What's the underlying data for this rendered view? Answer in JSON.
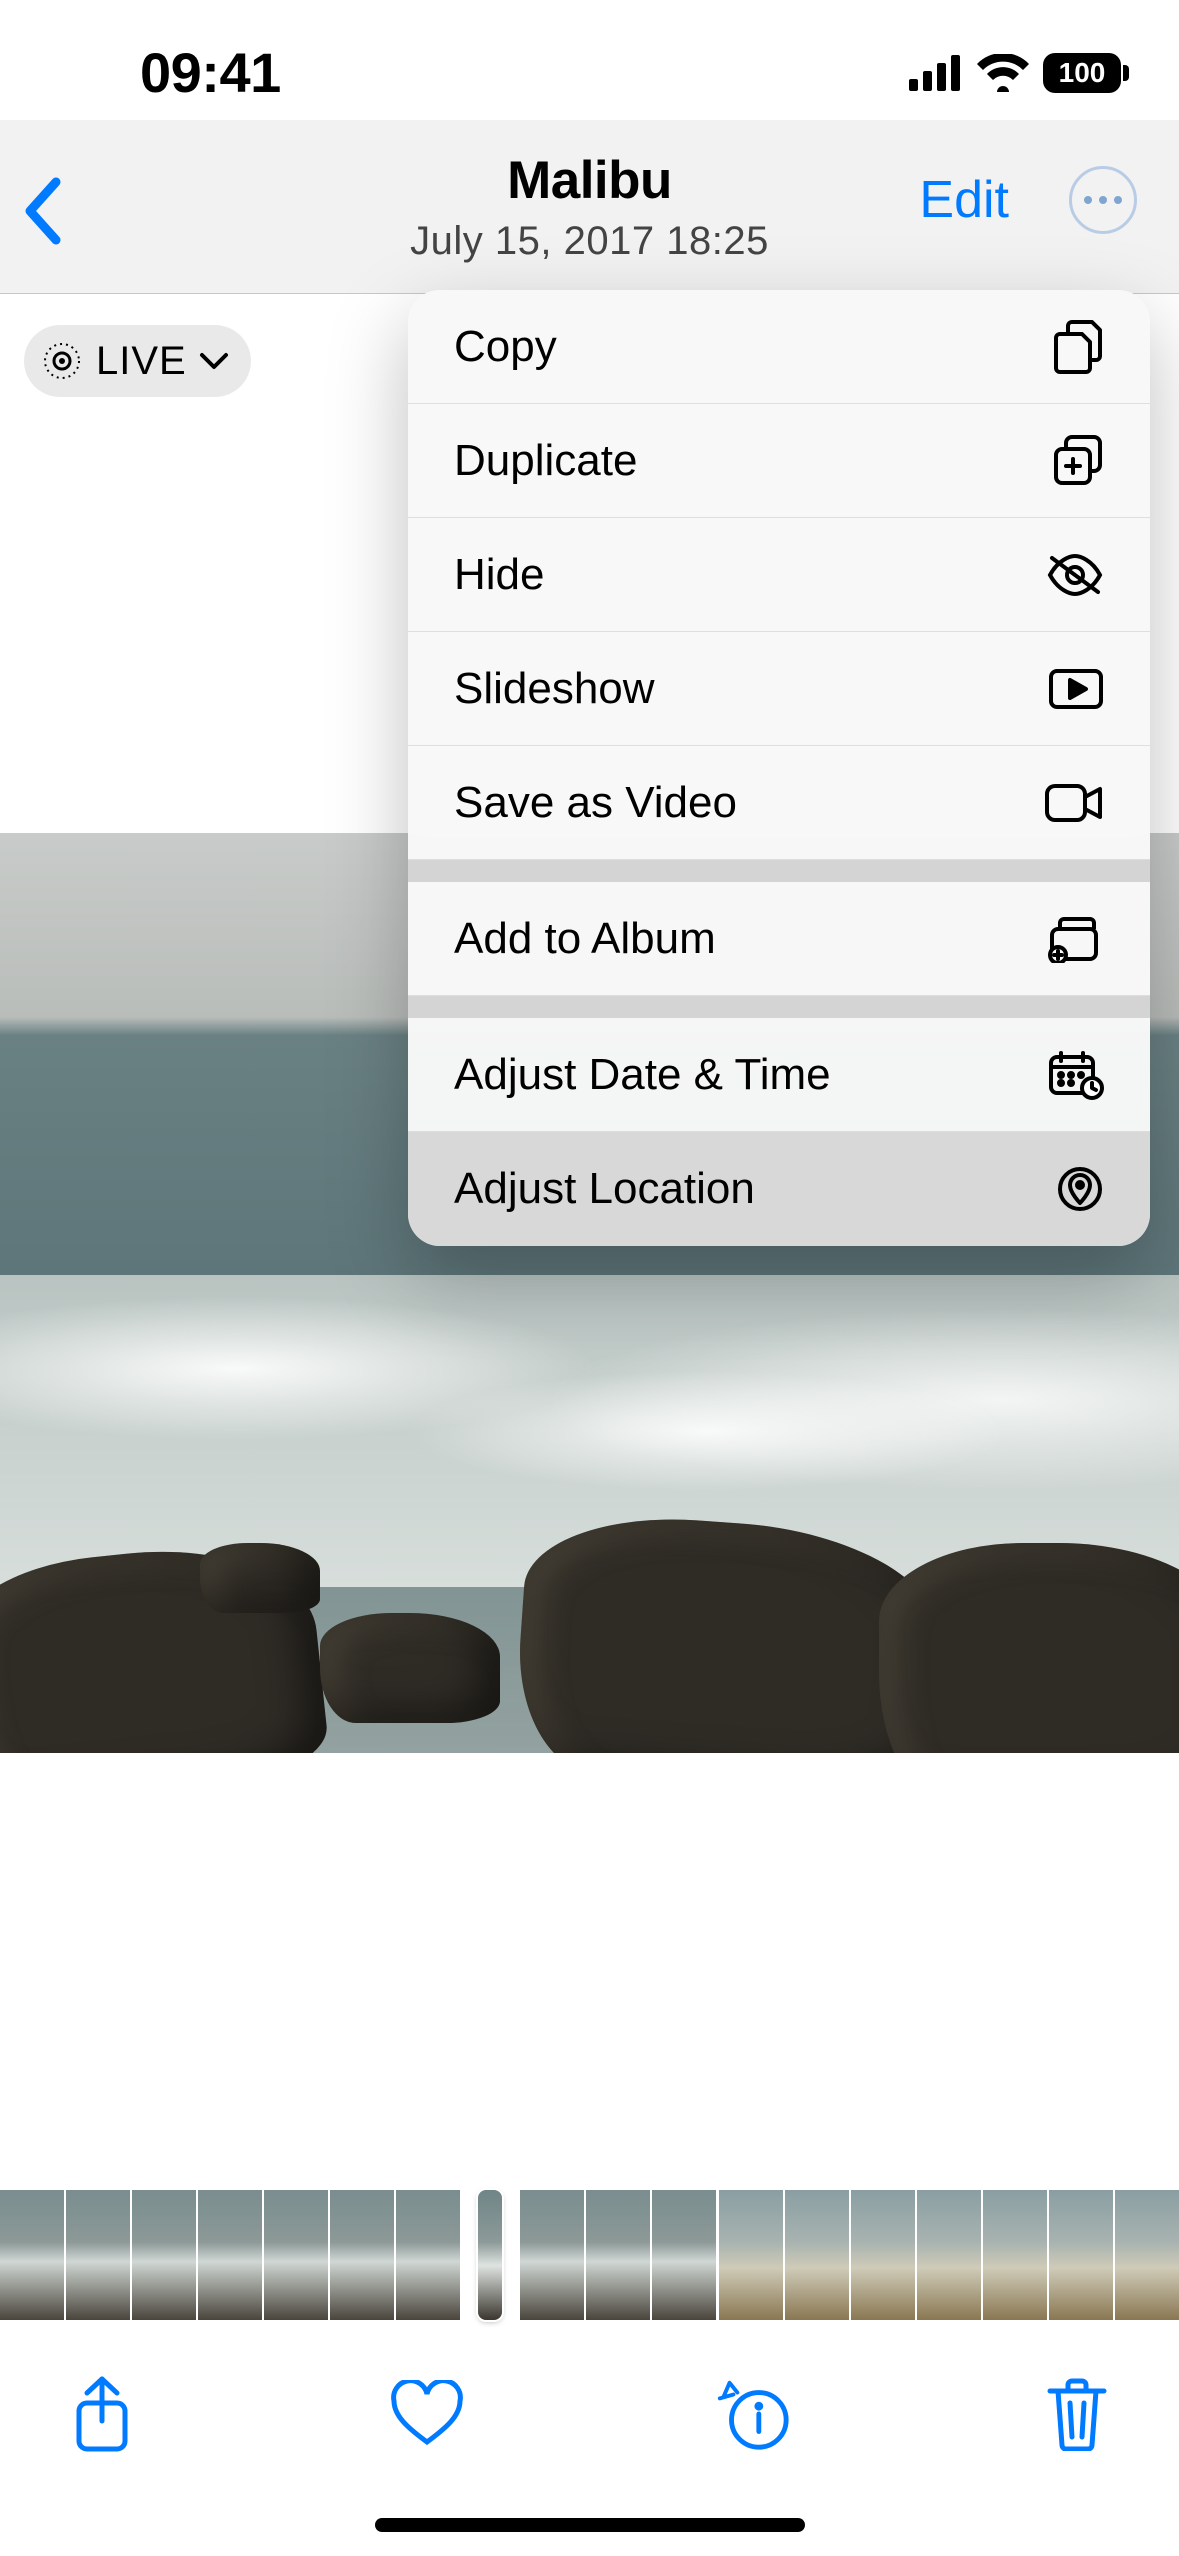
{
  "status": {
    "time": "09:41",
    "battery": "100"
  },
  "nav": {
    "title": "Malibu",
    "subtitle": "July 15, 2017  18:25",
    "edit_label": "Edit"
  },
  "live_badge": {
    "label": "LIVE"
  },
  "menu": {
    "groups": [
      [
        {
          "label": "Copy",
          "icon": "copy-icon"
        },
        {
          "label": "Duplicate",
          "icon": "duplicate-icon"
        },
        {
          "label": "Hide",
          "icon": "eye-slash-icon"
        },
        {
          "label": "Slideshow",
          "icon": "play-rect-icon"
        },
        {
          "label": "Save as Video",
          "icon": "video-icon"
        }
      ],
      [
        {
          "label": "Add to Album",
          "icon": "album-add-icon"
        }
      ],
      [
        {
          "label": "Adjust Date & Time",
          "icon": "calendar-clock-icon"
        },
        {
          "label": "Adjust Location",
          "icon": "location-circle-icon",
          "active": true
        }
      ]
    ]
  }
}
